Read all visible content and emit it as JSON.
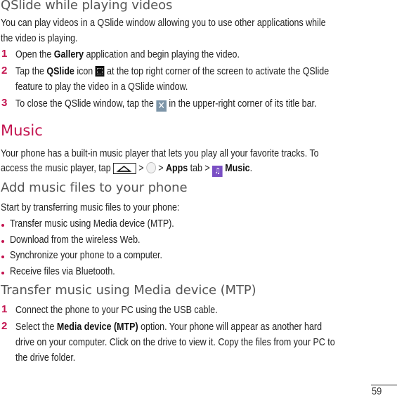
{
  "qslide": {
    "heading": "QSlide while playing videos",
    "intro_line1": "You can play videos in a QSlide window allowing you to use other applications while",
    "intro_line2": "the video is playing.",
    "steps": [
      {
        "num": "1",
        "pre": "Open the ",
        "bold": "Gallery",
        "post": " application and begin playing the video."
      },
      {
        "num": "2",
        "pre": "Tap the ",
        "bold": "QSlide",
        "mid": " icon ",
        "icon": "qslide-icon",
        "post": " at the top right corner of the screen to activate the QSlide",
        "cont": "feature to play the video in a QSlide window."
      },
      {
        "num": "3",
        "pre": "To close the QSlide window, tap the ",
        "icon": "close-icon",
        "post": " in the upper-right corner of its title bar."
      }
    ]
  },
  "music": {
    "heading": "Music",
    "intro_line1": "Your phone has a built-in music player that lets you play all your favorite tracks. To",
    "intro_pre": "access the music player, tap ",
    "gt1": " > ",
    "gt2": " > ",
    "apps_label": "Apps",
    "tab_text": " tab > ",
    "music_label": "Music",
    "end": ".",
    "icons": [
      "home-icon",
      "apps-icon",
      "music-app-icon"
    ]
  },
  "add_files": {
    "heading": "Add music files to your phone",
    "intro": "Start by transferring music files to your phone:",
    "bullets": [
      "Transfer music using Media device (MTP).",
      "Download from the wireless Web.",
      "Synchronize your phone to a computer.",
      "Receive files via Bluetooth."
    ]
  },
  "transfer": {
    "heading": "Transfer music using Media device (MTP)",
    "steps": [
      {
        "num": "1",
        "text": "Connect the phone to your PC using the USB cable."
      },
      {
        "num": "2",
        "pre": "Select the ",
        "bold": "Media device (MTP)",
        "post": " option. Your phone will appear as another hard",
        "cont1": "drive on your computer. Click on the drive to view it. Copy the files from your PC to",
        "cont2": "the drive folder."
      }
    ]
  },
  "page_number": "59",
  "colors": {
    "accent": "#c3134f",
    "heading_gray": "#555555"
  }
}
